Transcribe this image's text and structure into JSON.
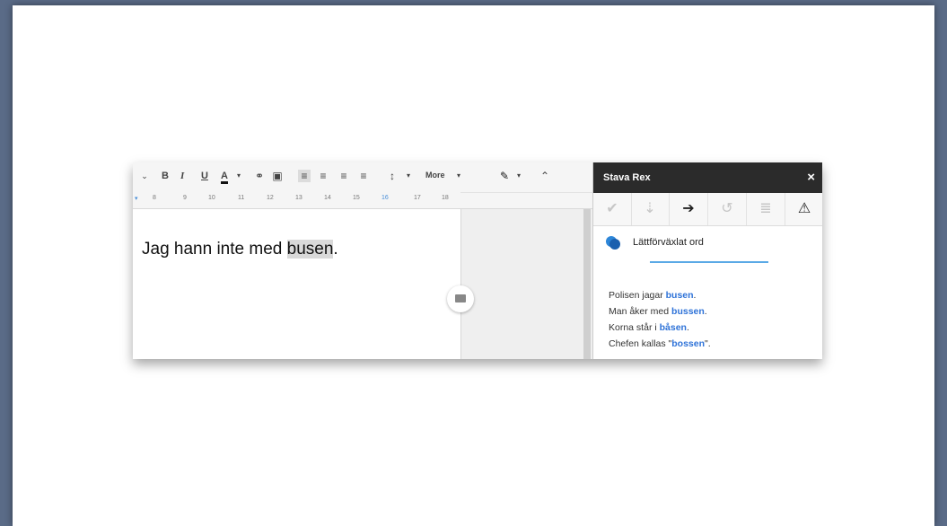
{
  "toolbar": {
    "items": [
      "B",
      "I",
      "U",
      "A",
      "More"
    ],
    "ruler": [
      "8",
      "9",
      "10",
      "11",
      "12",
      "13",
      "14",
      "15",
      "16",
      "17",
      "18"
    ]
  },
  "document": {
    "text_before": "Jag hann inte med ",
    "highlighted": "busen",
    "text_after": "."
  },
  "sidebar": {
    "title": "Stava Rex",
    "close": "×",
    "category": "Lättförväxlat ord",
    "examples": [
      {
        "before": "Polisen jagar ",
        "word": "busen",
        "after": "."
      },
      {
        "before": "Man åker med ",
        "word": "bussen",
        "after": "."
      },
      {
        "before": "Korna står i ",
        "word": "båsen",
        "after": "."
      },
      {
        "before": "Chefen kallas \"",
        "word": "bossen",
        "after": "\"."
      }
    ]
  }
}
